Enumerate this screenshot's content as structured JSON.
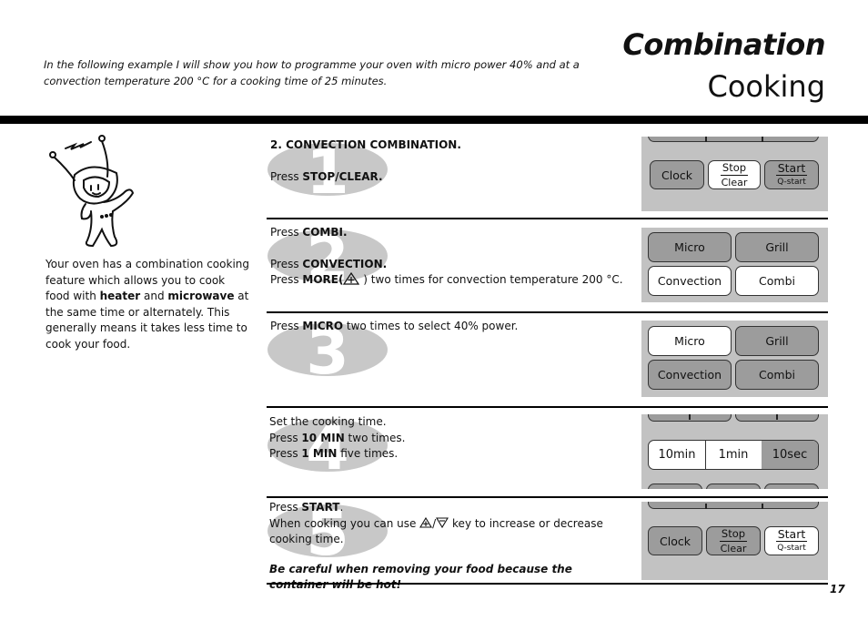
{
  "header": {
    "intro": "In the following example I will show you how to programme your oven with micro power 40% and at a convection temperature 200 °C for a cooking time of 25 minutes.",
    "title_line1": "Combination",
    "title_line2": "Cooking"
  },
  "sidebar": {
    "text_parts": [
      "Your oven has a combination cooking feature which allows you to cook food with ",
      "heater",
      " and ",
      "microwave",
      " at the same time or alternately. This generally means it takes less time to cook your food."
    ]
  },
  "steps": [
    {
      "number": "1",
      "heading": "2. CONVECTION COMBINATION.",
      "lines": [
        [
          "Press ",
          "STOP/CLEAR."
        ]
      ],
      "panel": {
        "keys": [
          {
            "label": "Clock",
            "active": false
          },
          {
            "top": "Stop",
            "bottom": "Clear",
            "active": true
          },
          {
            "top": "Start",
            "bottom": "Q-start",
            "active": false
          }
        ]
      }
    },
    {
      "number": "2",
      "lines": [
        [
          "Press ",
          "COMBI."
        ],
        [
          "Press ",
          "CONVECTION."
        ],
        [
          "Press ",
          "MORE(",
          " ) two times for convection temperature 200 °C."
        ]
      ],
      "more_icon": "plus-triangle-icon",
      "panel": {
        "keys": [
          {
            "label": "Micro",
            "active": false
          },
          {
            "label": "Grill",
            "active": false
          },
          {
            "label": "Convection",
            "active": true
          },
          {
            "label": "Combi",
            "active": true
          }
        ]
      }
    },
    {
      "number": "3",
      "lines": [
        [
          "Press ",
          "MICRO",
          " two times to select 40% power."
        ]
      ],
      "panel": {
        "keys": [
          {
            "label": "Micro",
            "active": true
          },
          {
            "label": "Grill",
            "active": false
          },
          {
            "label": "Convection",
            "active": false
          },
          {
            "label": "Combi",
            "active": false
          }
        ]
      }
    },
    {
      "number": "4",
      "lines": [
        [
          "Set the cooking time."
        ],
        [
          "Press ",
          "10 MIN",
          " two times."
        ],
        [
          "Press ",
          "1 MIN",
          " five times."
        ]
      ],
      "panel": {
        "keys": [
          {
            "label": "10min",
            "active": true
          },
          {
            "label": "1min",
            "active": true
          },
          {
            "label": "10sec",
            "active": false
          }
        ]
      }
    },
    {
      "number": "5",
      "lines": [
        [
          "Press ",
          "START",
          "."
        ],
        [
          "When cooking you can use ",
          "/",
          " key to increase or decrease cooking time."
        ]
      ],
      "warning": "Be careful when removing your food because the container will be hot!",
      "panel": {
        "keys": [
          {
            "label": "Clock",
            "active": false
          },
          {
            "top": "Stop",
            "bottom": "Clear",
            "active": false
          },
          {
            "top": "Start",
            "bottom": "Q-start",
            "active": true
          }
        ]
      }
    }
  ],
  "footer": {
    "page_number": "17"
  }
}
